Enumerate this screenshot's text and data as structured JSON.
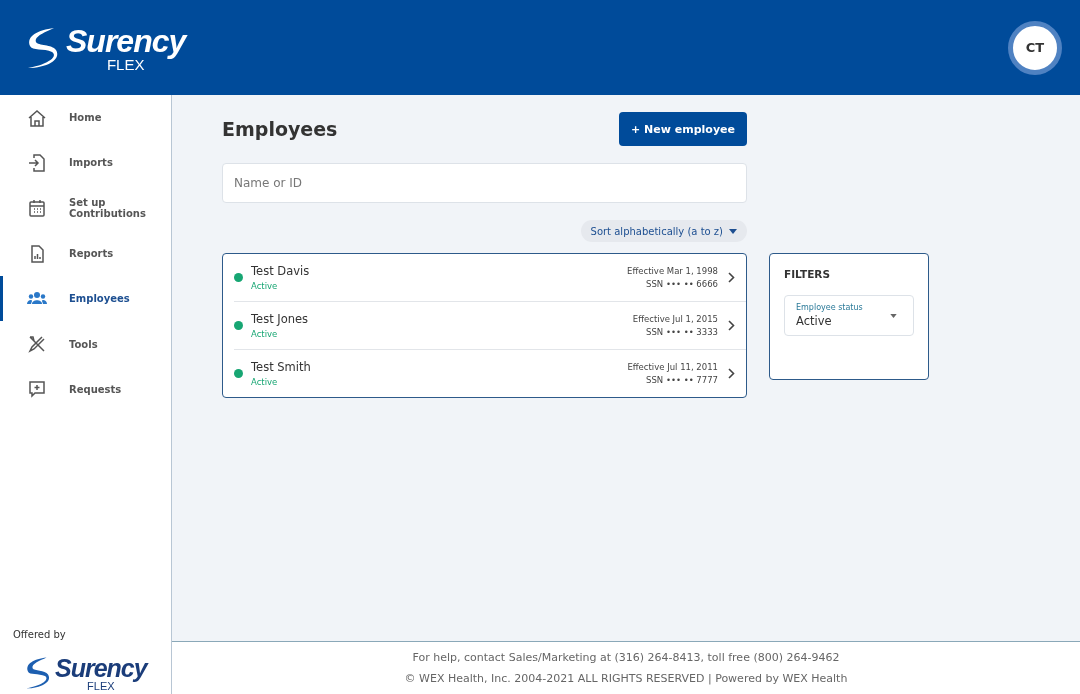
{
  "header": {
    "logo": {
      "brand": "Surency",
      "product": "FLEX"
    },
    "avatar": "CT"
  },
  "sidebar": {
    "items": [
      {
        "label": "Home",
        "selected": false
      },
      {
        "label": "Imports",
        "selected": false
      },
      {
        "label": "Set up Contributions",
        "selected": false
      },
      {
        "label": "Reports",
        "selected": false
      },
      {
        "label": "Employees",
        "selected": true
      },
      {
        "label": "Tools",
        "selected": false
      },
      {
        "label": "Requests",
        "selected": false
      }
    ],
    "offered_by": "Offered by",
    "partner_logo": {
      "brand": "Surency",
      "product": "FLEX"
    }
  },
  "page": {
    "title": "Employees",
    "new_button": "+ New employee",
    "search": {
      "placeholder": "Name or ID"
    },
    "sort": "Sort alphabetically (a to z)",
    "employees": [
      {
        "name": "Test Davis",
        "status": "Active",
        "color": "#17a673",
        "effective": "Effective Mar 1, 1998",
        "ssn": "SSN ••• •• 6666"
      },
      {
        "name": "Test Jones",
        "status": "Active",
        "color": "#17a673",
        "effective": "Effective Jul 1, 2015",
        "ssn": "SSN ••• •• 3333"
      },
      {
        "name": "Test Smith",
        "status": "Active",
        "color": "#17a673",
        "effective": "Effective Jul 11, 2011",
        "ssn": "SSN ••• •• 7777"
      }
    ],
    "filters": {
      "title": "FILTERS",
      "status_label": "Employee status",
      "status_value": "Active"
    }
  },
  "footer": {
    "help": "For help, contact Sales/Marketing at (316) 264-8413, toll free (800) 264-9462",
    "copyright": "© WEX Health, Inc. 2004-2021 ALL RIGHTS RESERVED | Powered by WEX Health"
  }
}
